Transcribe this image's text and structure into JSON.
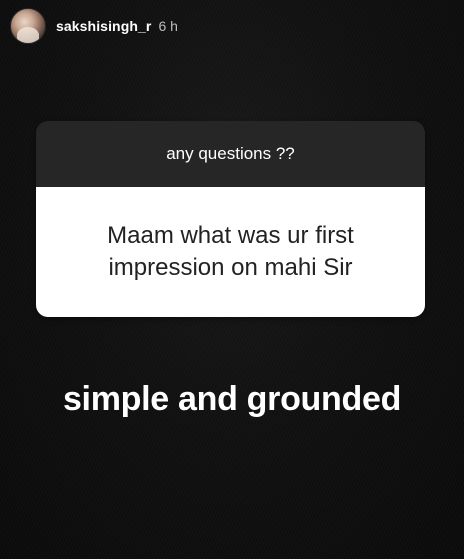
{
  "header": {
    "username": "sakshisingh_r",
    "time": "6 h",
    "avatar_icon": "profile-photo"
  },
  "question_sticker": {
    "prompt": "any questions ??",
    "question": "Maam what was ur first impression on mahi Sir"
  },
  "answer_text": "simple and grounded",
  "colors": {
    "background": "#0e0e0e",
    "sticker_header": "#262626",
    "sticker_body": "#ffffff",
    "text_light": "#ffffff",
    "text_dark": "#222222"
  }
}
